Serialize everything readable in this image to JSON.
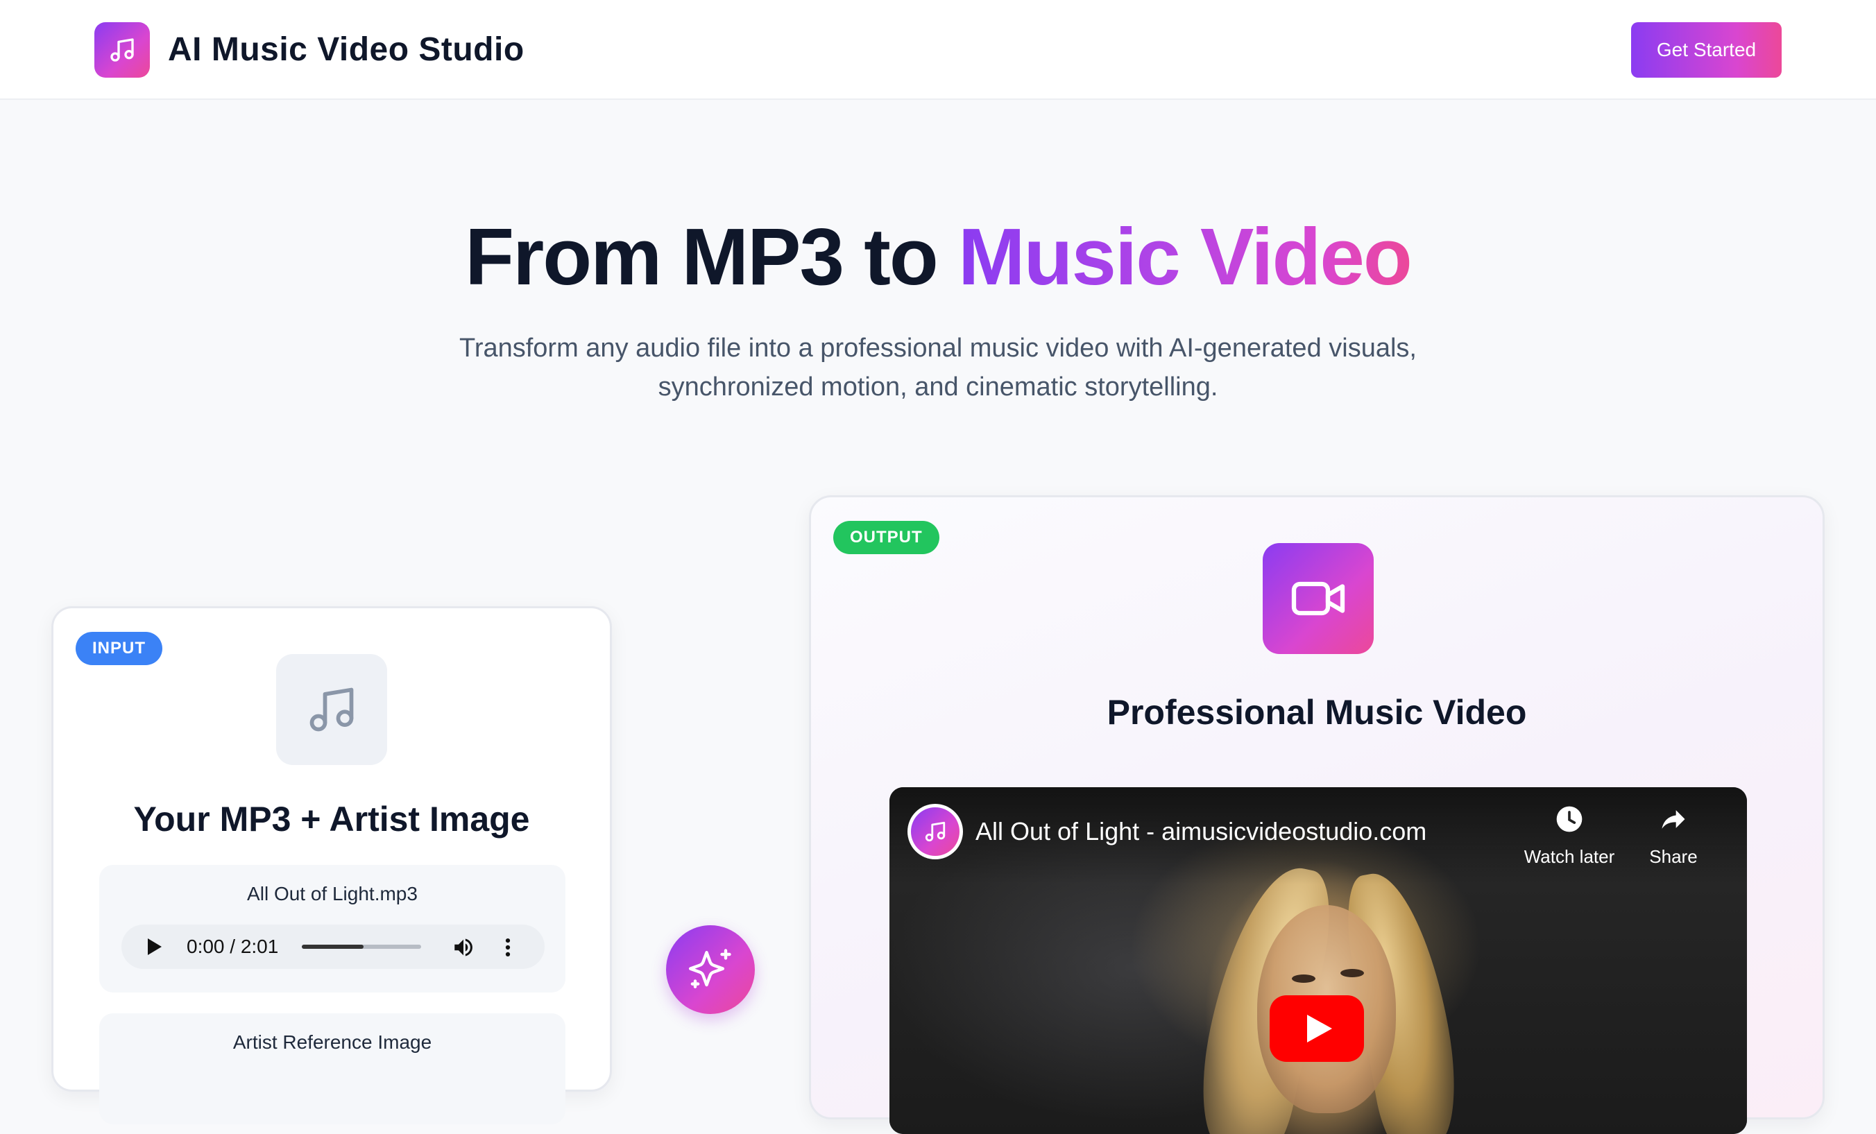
{
  "header": {
    "brand_name": "AI Music Video Studio",
    "cta_label": "Get Started"
  },
  "hero": {
    "title_plain": "From MP3 to ",
    "title_accent": "Music Video",
    "subtitle_line1": "Transform any audio file into a professional music video with AI-generated visuals,",
    "subtitle_line2": "synchronized motion, and cinematic storytelling."
  },
  "input_card": {
    "badge": "INPUT",
    "title": "Your MP3 + Artist Image",
    "audio": {
      "filename": "All Out of Light.mp3",
      "time": "0:00 / 2:01",
      "progress_fraction": 0.52
    },
    "reference_label": "Artist Reference Image"
  },
  "output_card": {
    "badge": "OUTPUT",
    "title": "Professional Music Video",
    "video": {
      "title": "All Out of Light - aimusicvideostudio.com",
      "watch_later_label": "Watch later",
      "share_label": "Share"
    }
  },
  "colors": {
    "brand_gradient_start": "#8b3cf1",
    "brand_gradient_end": "#ec4899",
    "input_badge": "#3b82f6",
    "output_badge": "#22c55e",
    "youtube_red": "#ff0000"
  },
  "icons": {
    "brand": "music-note-icon",
    "input": "music-note-icon",
    "connector": "sparkles-icon",
    "output": "video-camera-icon",
    "watch_later": "clock-icon",
    "share": "share-arrow-icon",
    "video_play": "youtube-play-icon"
  }
}
